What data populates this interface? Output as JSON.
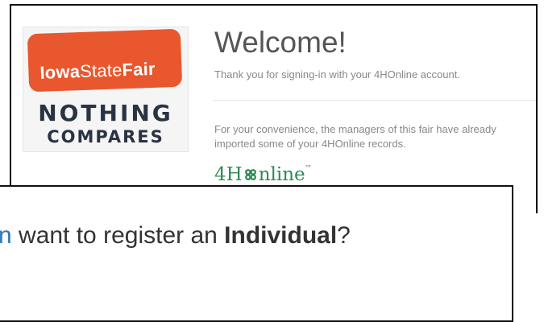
{
  "logo": {
    "word1": "Iowa",
    "word2": "State",
    "word3": "Fair",
    "tagline1": "NOTHING",
    "tagline2": "COMPARES"
  },
  "welcome": {
    "title": "Welcome!",
    "subtitle": "Thank you for signing-in with your 4HOnline account."
  },
  "records": {
    "note": "For your convenience, the managers of this fair have already imported some of your 4HOnline records.",
    "brand_prefix": "4H",
    "brand_suffix": "nline",
    "brand_tm": "™",
    "brand_icon": "clover-icon"
  },
  "register": {
    "lead": "n",
    "text": " want to register an ",
    "emphasis": "Individual",
    "end": "?"
  },
  "colors": {
    "fair_orange": "#e8572e",
    "tagline_navy": "#2a3342",
    "brand_green": "#2e8b57",
    "link_blue": "#2e79b9"
  }
}
